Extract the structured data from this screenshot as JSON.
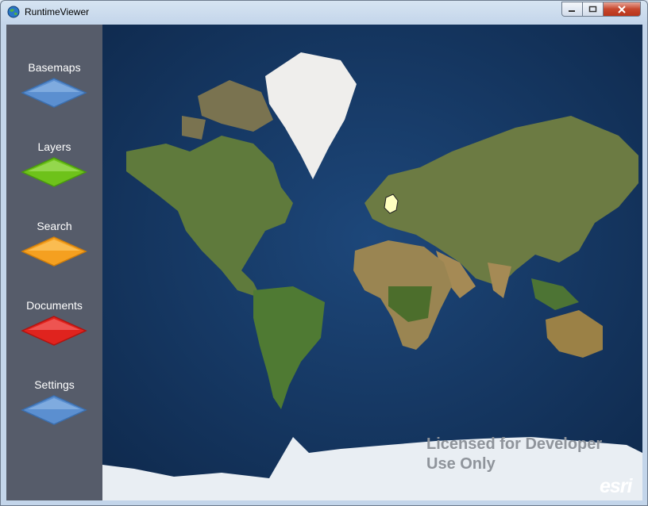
{
  "window": {
    "title": "RuntimeViewer"
  },
  "sidebar": {
    "items": [
      {
        "label": "Basemaps",
        "color": "#5b8fd0"
      },
      {
        "label": "Layers",
        "color": "#6ec21a"
      },
      {
        "label": "Search",
        "color": "#f5a020"
      },
      {
        "label": "Documents",
        "color": "#e0231e"
      },
      {
        "label": "Settings",
        "color": "#5b8fd0"
      }
    ]
  },
  "map": {
    "watermark": "Licensed for Developer\nUse Only",
    "logo": "esri",
    "highlight_country": "Germany"
  }
}
